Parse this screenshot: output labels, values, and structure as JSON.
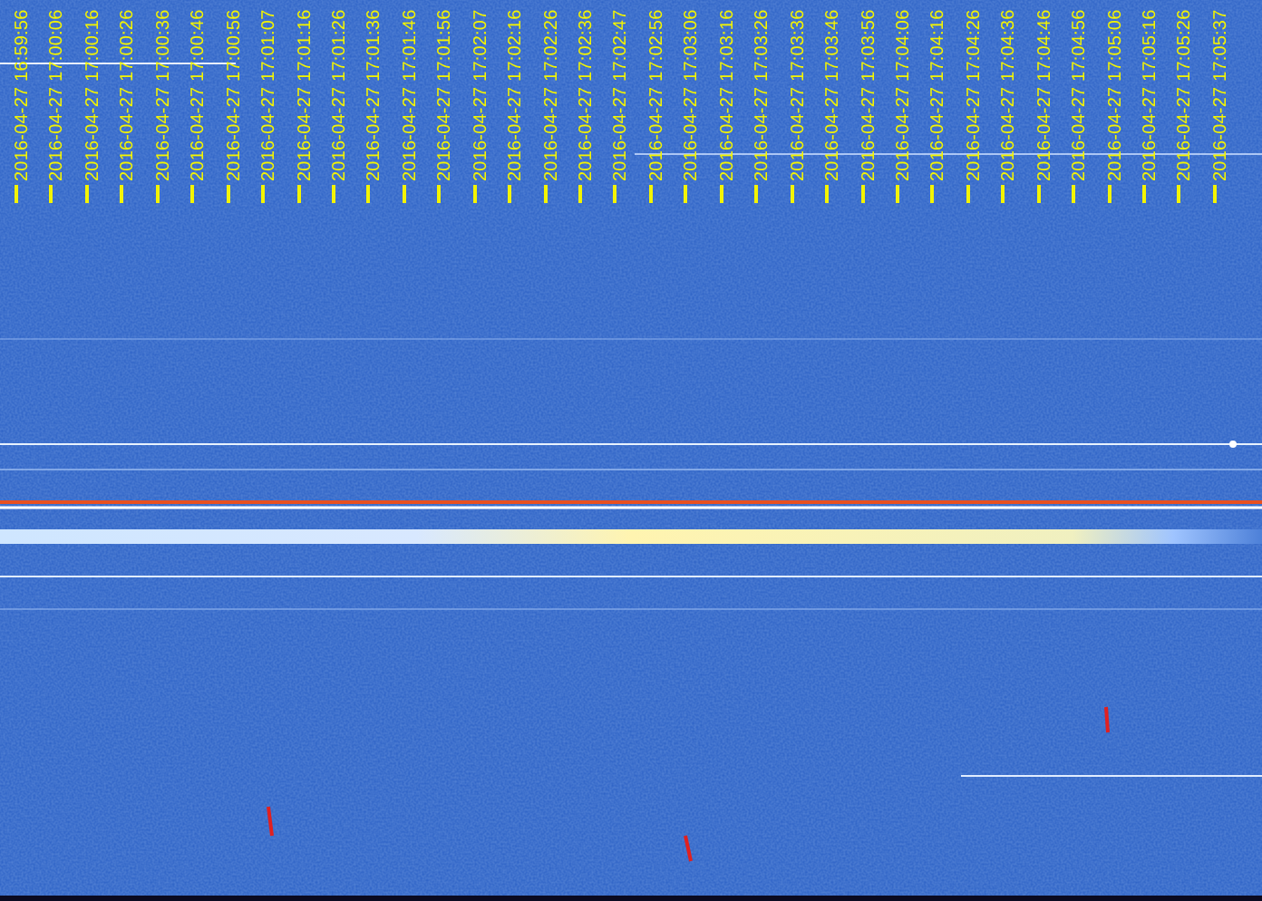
{
  "waterfall": {
    "time_labels": [
      "2016-04-27 16:59:56",
      "2016-04-27 17:00:06",
      "2016-04-27 17:00:16",
      "2016-04-27 17:00:26",
      "2016-04-27 17:00:36",
      "2016-04-27 17:00:46",
      "2016-04-27 17:00:56",
      "2016-04-27 17:01:07",
      "2016-04-27 17:01:16",
      "2016-04-27 17:01:26",
      "2016-04-27 17:01:36",
      "2016-04-27 17:01:46",
      "2016-04-27 17:01:56",
      "2016-04-27 17:02:07",
      "2016-04-27 17:02:16",
      "2016-04-27 17:02:26",
      "2016-04-27 17:02:36",
      "2016-04-27 17:02:47",
      "2016-04-27 17:02:56",
      "2016-04-27 17:03:06",
      "2016-04-27 17:03:16",
      "2016-04-27 17:03:26",
      "2016-04-27 17:03:36",
      "2016-04-27 17:03:46",
      "2016-04-27 17:03:56",
      "2016-04-27 17:04:06",
      "2016-04-27 17:04:16",
      "2016-04-27 17:04:26",
      "2016-04-27 17:04:36",
      "2016-04-27 17:04:46",
      "2016-04-27 17:04:56",
      "2016-04-27 17:05:06",
      "2016-04-27 17:05:16",
      "2016-04-27 17:05:26",
      "2016-04-27 17:05:37"
    ]
  }
}
